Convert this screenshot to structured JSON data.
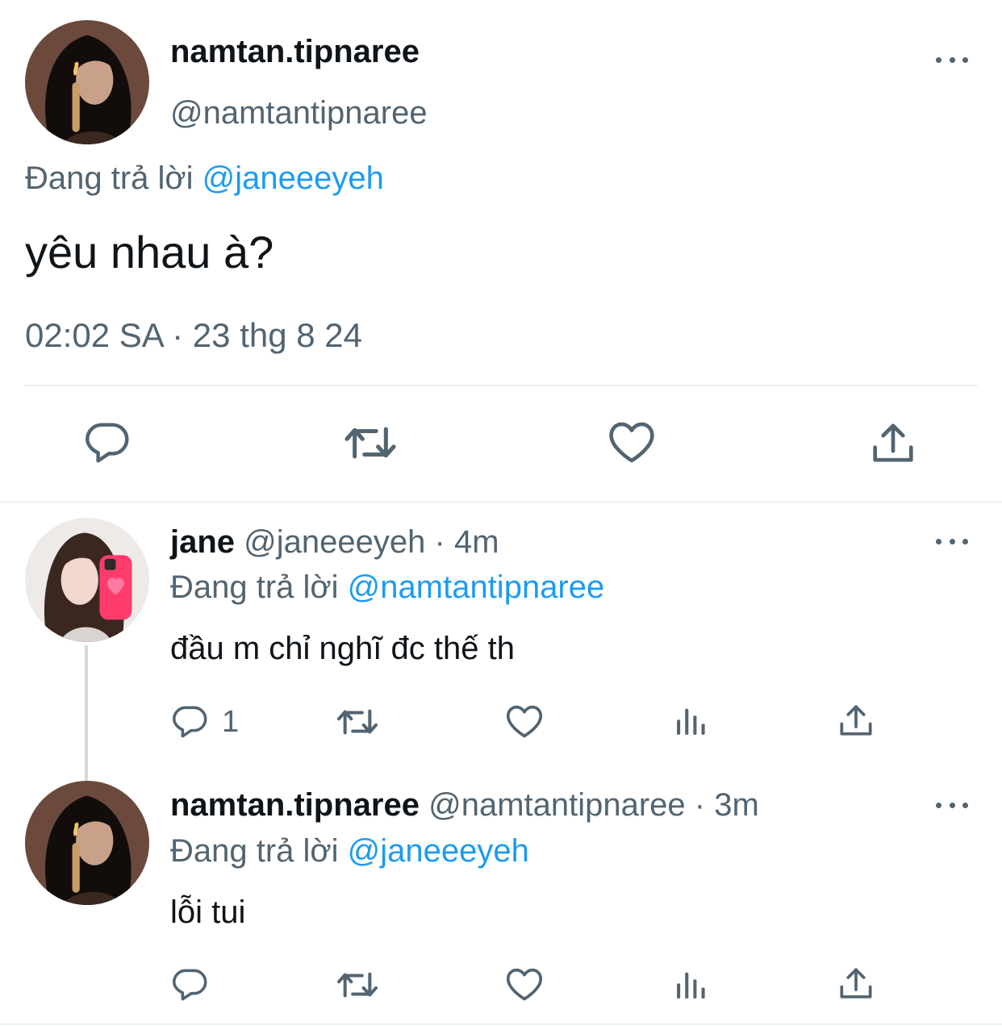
{
  "main_tweet": {
    "display_name": "namtan.tipnaree",
    "handle": "@namtantipnaree",
    "reply_prefix": "Đang trả lời",
    "reply_to": "@janeeeyeh",
    "text": "yêu nhau à?",
    "timestamp": "02:02 SA · 23 thg 8 24"
  },
  "replies": [
    {
      "display_name": "jane",
      "handle": "@janeeeyeh",
      "time": "· 4m",
      "reply_prefix": "Đang trả lời",
      "reply_to": "@namtantipnaree",
      "text": "đầu m chỉ nghĩ đc thế th",
      "reply_count": "1"
    },
    {
      "display_name": "namtan.tipnaree",
      "handle": "@namtantipnaree",
      "time": "· 3m",
      "reply_prefix": "Đang trả lời",
      "reply_to": "@janeeeyeh",
      "text": "lỗi tui",
      "reply_count": ""
    }
  ],
  "icons": [
    "reply-icon",
    "retweet-icon",
    "like-icon",
    "share-icon",
    "views-icon",
    "more-icon"
  ],
  "colors": {
    "link": "#1d9bf0",
    "muted": "#536471",
    "text": "#0f1419",
    "divider": "#eff3f4"
  }
}
